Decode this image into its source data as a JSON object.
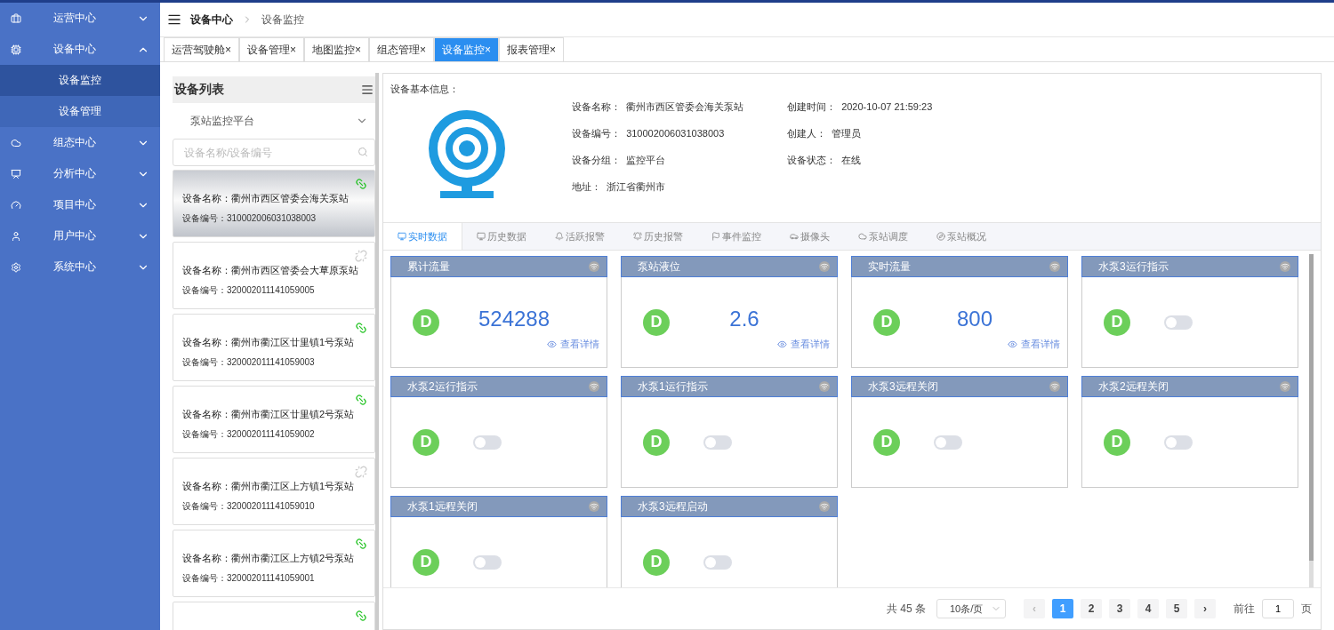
{
  "sidebar": {
    "items": [
      {
        "label": "运营中心",
        "expanded": false
      },
      {
        "label": "设备中心",
        "expanded": true,
        "children": [
          {
            "label": "设备监控",
            "selected": true
          },
          {
            "label": "设备管理",
            "selected": false
          }
        ]
      },
      {
        "label": "组态中心",
        "expanded": false
      },
      {
        "label": "分析中心",
        "expanded": false
      },
      {
        "label": "项目中心",
        "expanded": false
      },
      {
        "label": "用户中心",
        "expanded": false
      },
      {
        "label": "系统中心",
        "expanded": false
      }
    ]
  },
  "breadcrumb": [
    "设备中心",
    "设备监控"
  ],
  "tabs": [
    {
      "label": "运营驾驶舱",
      "close": "×",
      "selected": false
    },
    {
      "label": "设备管理",
      "close": "×",
      "selected": false
    },
    {
      "label": "地图监控",
      "close": "×",
      "selected": false
    },
    {
      "label": "组态管理",
      "close": "×",
      "selected": false
    },
    {
      "label": "设备监控",
      "close": "×",
      "selected": true
    },
    {
      "label": "报表管理",
      "close": "×",
      "selected": false
    }
  ],
  "device_list": {
    "title": "设备列表",
    "group": "泵站监控平台",
    "search_placeholder": "设备名称/设备编号",
    "devices": [
      {
        "name": "设备名称：衢州市西区管委会海关泵站",
        "code": "设备编号：310002006031038003",
        "connected": true,
        "selected": true
      },
      {
        "name": "设备名称：衢州市西区管委会大草原泵站",
        "code": "设备编号：320002011141059005",
        "connected": false,
        "selected": false
      },
      {
        "name": "设备名称：衢州市衢江区廿里镇1号泵站",
        "code": "设备编号：320002011141059003",
        "connected": true,
        "selected": false
      },
      {
        "name": "设备名称：衢州市衢江区廿里镇2号泵站",
        "code": "设备编号：320002011141059002",
        "connected": true,
        "selected": false
      },
      {
        "name": "设备名称：衢州市衢江区上方镇1号泵站",
        "code": "设备编号：320002011141059010",
        "connected": false,
        "selected": false
      },
      {
        "name": "设备名称：衢州市衢江区上方镇2号泵站",
        "code": "设备编号：320002011141059001",
        "connected": true,
        "selected": false
      },
      {
        "connected": true,
        "selected": false
      }
    ]
  },
  "device_info": {
    "title": "设备基本信息：",
    "fields": [
      {
        "label": "设备名称：",
        "value": "衢州市西区管委会海关泵站"
      },
      {
        "label": "创建时间：",
        "value": "2020-10-07 21:59:23"
      },
      {
        "label": "设备编号：",
        "value": "310002006031038003"
      },
      {
        "label": "创建人：",
        "value": "管理员"
      },
      {
        "label": "设备分组：",
        "value": "监控平台"
      },
      {
        "label": "设备状态：",
        "value": "在线"
      },
      {
        "label": "地址：",
        "value": "浙江省衢州市"
      }
    ]
  },
  "data_tabs": [
    {
      "label": "实时数据",
      "selected": true
    },
    {
      "label": "历史数据",
      "selected": false
    },
    {
      "label": "活跃报警",
      "selected": false
    },
    {
      "label": "历史报警",
      "selected": false
    },
    {
      "label": "事件监控",
      "selected": false
    },
    {
      "label": "摄像头",
      "selected": false
    },
    {
      "label": "泵站调度",
      "selected": false
    },
    {
      "label": "泵站概况",
      "selected": false
    }
  ],
  "widgets": [
    {
      "kind": "value",
      "title": "累计流量",
      "badge": "D",
      "value": "524288",
      "link": "查看详情"
    },
    {
      "kind": "value",
      "title": "泵站液位",
      "badge": "D",
      "value": "2.6",
      "link": "查看详情"
    },
    {
      "kind": "value",
      "title": "实时流量",
      "badge": "D",
      "value": "800",
      "link": "查看详情"
    },
    {
      "kind": "switch",
      "title": "水泵3运行指示",
      "badge": "D",
      "on": false
    },
    {
      "kind": "switch",
      "title": "水泵2运行指示",
      "badge": "D",
      "on": false
    },
    {
      "kind": "switch",
      "title": "水泵1运行指示",
      "badge": "D",
      "on": false
    },
    {
      "kind": "switch",
      "title": "水泵3远程关闭",
      "badge": "D",
      "on": false
    },
    {
      "kind": "switch",
      "title": "水泵2远程关闭",
      "badge": "D",
      "on": false
    },
    {
      "kind": "switch",
      "title": "水泵1远程关闭",
      "badge": "D",
      "on": false
    },
    {
      "kind": "switch",
      "title": "水泵3远程启动",
      "badge": "D",
      "on": false
    }
  ],
  "pagination": {
    "total": "共 45 条",
    "page_size": "10条/页",
    "prev": "‹",
    "next": "›",
    "pages": [
      {
        "label": "1",
        "selected": true
      },
      {
        "label": "2",
        "selected": false
      },
      {
        "label": "3",
        "selected": false
      },
      {
        "label": "4",
        "selected": false
      },
      {
        "label": "5",
        "selected": false
      }
    ],
    "goto_label": "前往",
    "goto_value": "1",
    "goto_suffix": "页"
  }
}
